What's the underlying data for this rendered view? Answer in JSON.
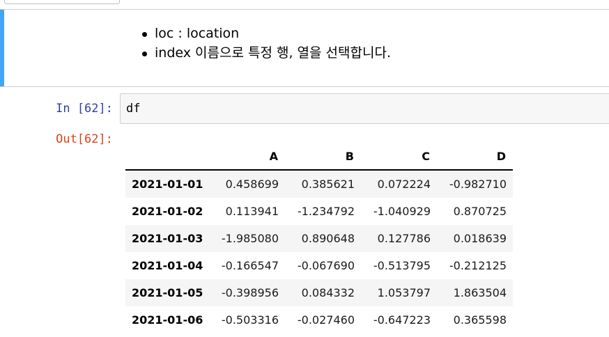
{
  "markdown_cell": {
    "bullets": [
      "loc : location",
      "index 이름으로 특정 행, 열을 선택합니다."
    ]
  },
  "code_cell": {
    "in_prompt": "In [62]:",
    "out_prompt": "Out[62]:",
    "code": "df"
  },
  "dataframe": {
    "columns": [
      "A",
      "B",
      "C",
      "D"
    ],
    "rows": [
      {
        "index": "2021-01-01",
        "values": [
          "0.458699",
          "0.385621",
          "0.072224",
          "-0.982710"
        ]
      },
      {
        "index": "2021-01-02",
        "values": [
          "0.113941",
          "-1.234792",
          "-1.040929",
          "0.870725"
        ]
      },
      {
        "index": "2021-01-03",
        "values": [
          "-1.985080",
          "0.890648",
          "0.127786",
          "0.018639"
        ]
      },
      {
        "index": "2021-01-04",
        "values": [
          "-0.166547",
          "-0.067690",
          "-0.513795",
          "-0.212125"
        ]
      },
      {
        "index": "2021-01-05",
        "values": [
          "-0.398956",
          "0.084332",
          "1.053797",
          "1.863504"
        ]
      },
      {
        "index": "2021-01-06",
        "values": [
          "-0.503316",
          "-0.027460",
          "-0.647223",
          "0.365598"
        ]
      }
    ]
  },
  "colors": {
    "selected_cell_bar": "#42a5f5",
    "in_prompt": "#303f9f",
    "out_prompt": "#d84315"
  }
}
